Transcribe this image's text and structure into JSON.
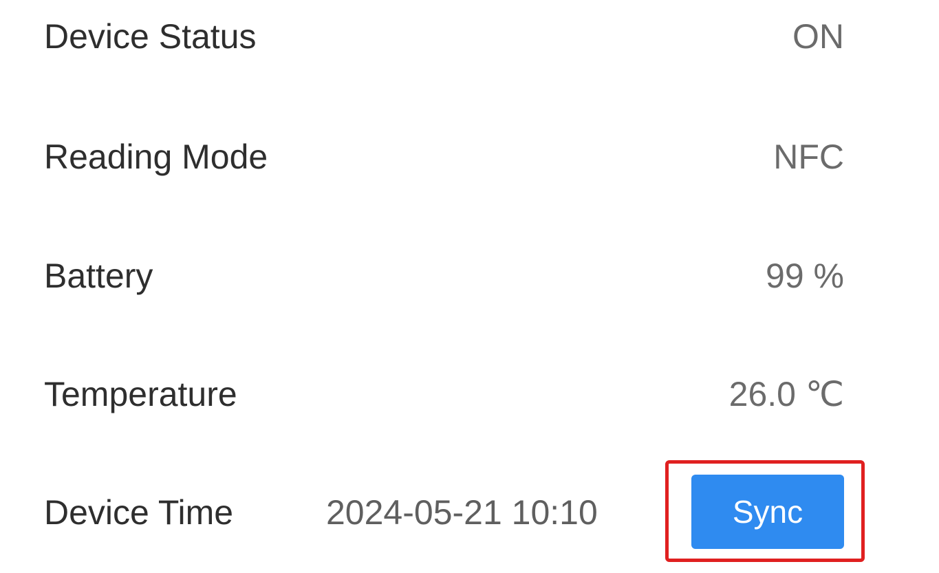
{
  "rows": [
    {
      "label": "Device Status",
      "value": "ON"
    },
    {
      "label": "Reading Mode",
      "value": "NFC"
    },
    {
      "label": "Battery",
      "value": "99 %"
    },
    {
      "label": "Temperature",
      "value": "26.0 ℃"
    }
  ],
  "device_time": {
    "label": "Device Time",
    "value": "2024-05-21 10:10",
    "sync_label": "Sync"
  },
  "colors": {
    "sync_button": "#2f8bf0",
    "highlight": "#e02020"
  }
}
